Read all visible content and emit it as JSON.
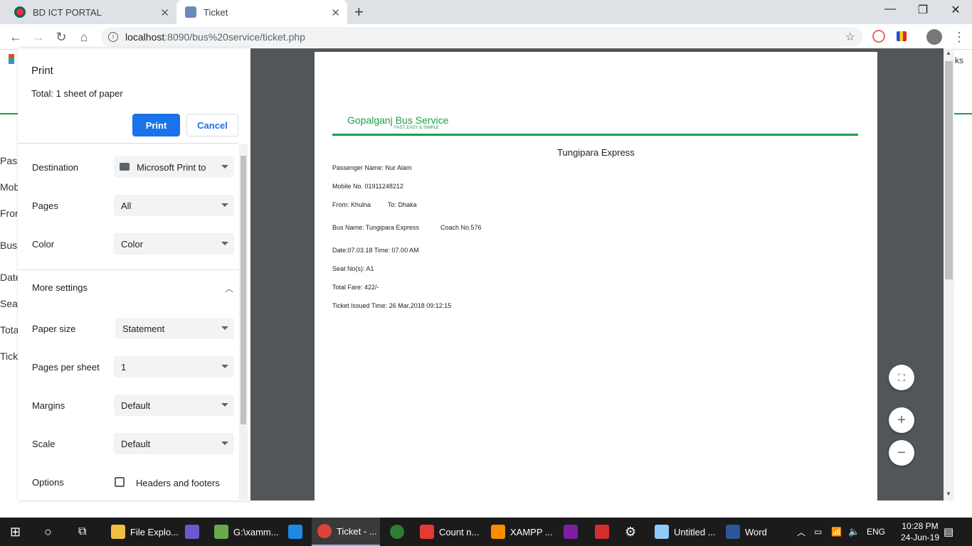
{
  "browser": {
    "tabs": [
      {
        "title": "BD ICT PORTAL",
        "favicon": "bd-flag-icon"
      },
      {
        "title": "Ticket",
        "favicon": "bus-icon"
      }
    ],
    "url_host": "localhost",
    "url_path": ":8090/bus%20service/ticket.php"
  },
  "background_labels": [
    "Pass",
    "Mob",
    "Fron",
    "Bus",
    "Date",
    "Seat",
    "Tota",
    "Tick"
  ],
  "bookmarks_tail": "ks",
  "print": {
    "title": "Print",
    "total": "Total: 1 sheet of paper",
    "print_label": "Print",
    "cancel_label": "Cancel",
    "destination_label": "Destination",
    "destination_value": "Microsoft Print to",
    "pages_label": "Pages",
    "pages_value": "All",
    "color_label": "Color",
    "color_value": "Color",
    "more_settings_label": "More settings",
    "paper_size_label": "Paper size",
    "paper_size_value": "Statement",
    "pages_per_sheet_label": "Pages per sheet",
    "pages_per_sheet_value": "1",
    "margins_label": "Margins",
    "margins_value": "Default",
    "scale_label": "Scale",
    "scale_value": "Default",
    "options_label": "Options",
    "headers_footers_label": "Headers and footers"
  },
  "ticket": {
    "brand": "Gopalganj Bus Service",
    "tagline": "FAST, EASY & SIMPLE",
    "title": "Tungipara Express",
    "passenger": "Passenger Name: Nur Alam",
    "mobile": "Mobile No. 01911248212",
    "from": "From: Khulna",
    "to": "To: Dhaka",
    "bus_name": "Bus Name: Tungipara Express",
    "coach": "Coach No.576",
    "date_time": "Date:07.03.18 Time: 07.00 AM",
    "seat": "Seat No(s): A1",
    "fare": "Total Fare: 422/-",
    "issued": "Ticket Issued Time: 26 Mar,2018 09:12:15"
  },
  "taskbar": {
    "items": [
      "File Explo...",
      "G:\\xamm...",
      "Ticket - ...",
      "Count n...",
      "XAMPP ...",
      "Untitled ...",
      "Word"
    ],
    "lang": "ENG",
    "time": "10:28 PM",
    "date": "24-Jun-19"
  },
  "colors": {
    "accent": "#1a73e8",
    "brand_green": "#1e9e4a",
    "preview_bg": "#525659"
  }
}
